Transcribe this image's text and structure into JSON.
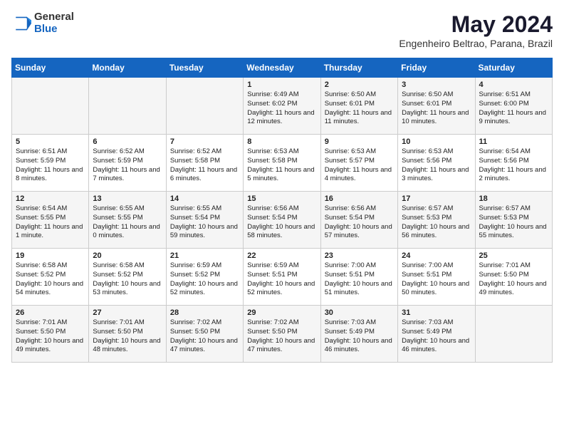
{
  "header": {
    "logo_general": "General",
    "logo_blue": "Blue",
    "month": "May 2024",
    "location": "Engenheiro Beltrao, Parana, Brazil"
  },
  "weekdays": [
    "Sunday",
    "Monday",
    "Tuesday",
    "Wednesday",
    "Thursday",
    "Friday",
    "Saturday"
  ],
  "weeks": [
    [
      {
        "day": "",
        "info": ""
      },
      {
        "day": "",
        "info": ""
      },
      {
        "day": "",
        "info": ""
      },
      {
        "day": "1",
        "info": "Sunrise: 6:49 AM\nSunset: 6:02 PM\nDaylight: 11 hours and 12 minutes."
      },
      {
        "day": "2",
        "info": "Sunrise: 6:50 AM\nSunset: 6:01 PM\nDaylight: 11 hours and 11 minutes."
      },
      {
        "day": "3",
        "info": "Sunrise: 6:50 AM\nSunset: 6:01 PM\nDaylight: 11 hours and 10 minutes."
      },
      {
        "day": "4",
        "info": "Sunrise: 6:51 AM\nSunset: 6:00 PM\nDaylight: 11 hours and 9 minutes."
      }
    ],
    [
      {
        "day": "5",
        "info": "Sunrise: 6:51 AM\nSunset: 5:59 PM\nDaylight: 11 hours and 8 minutes."
      },
      {
        "day": "6",
        "info": "Sunrise: 6:52 AM\nSunset: 5:59 PM\nDaylight: 11 hours and 7 minutes."
      },
      {
        "day": "7",
        "info": "Sunrise: 6:52 AM\nSunset: 5:58 PM\nDaylight: 11 hours and 6 minutes."
      },
      {
        "day": "8",
        "info": "Sunrise: 6:53 AM\nSunset: 5:58 PM\nDaylight: 11 hours and 5 minutes."
      },
      {
        "day": "9",
        "info": "Sunrise: 6:53 AM\nSunset: 5:57 PM\nDaylight: 11 hours and 4 minutes."
      },
      {
        "day": "10",
        "info": "Sunrise: 6:53 AM\nSunset: 5:56 PM\nDaylight: 11 hours and 3 minutes."
      },
      {
        "day": "11",
        "info": "Sunrise: 6:54 AM\nSunset: 5:56 PM\nDaylight: 11 hours and 2 minutes."
      }
    ],
    [
      {
        "day": "12",
        "info": "Sunrise: 6:54 AM\nSunset: 5:55 PM\nDaylight: 11 hours and 1 minute."
      },
      {
        "day": "13",
        "info": "Sunrise: 6:55 AM\nSunset: 5:55 PM\nDaylight: 11 hours and 0 minutes."
      },
      {
        "day": "14",
        "info": "Sunrise: 6:55 AM\nSunset: 5:54 PM\nDaylight: 10 hours and 59 minutes."
      },
      {
        "day": "15",
        "info": "Sunrise: 6:56 AM\nSunset: 5:54 PM\nDaylight: 10 hours and 58 minutes."
      },
      {
        "day": "16",
        "info": "Sunrise: 6:56 AM\nSunset: 5:54 PM\nDaylight: 10 hours and 57 minutes."
      },
      {
        "day": "17",
        "info": "Sunrise: 6:57 AM\nSunset: 5:53 PM\nDaylight: 10 hours and 56 minutes."
      },
      {
        "day": "18",
        "info": "Sunrise: 6:57 AM\nSunset: 5:53 PM\nDaylight: 10 hours and 55 minutes."
      }
    ],
    [
      {
        "day": "19",
        "info": "Sunrise: 6:58 AM\nSunset: 5:52 PM\nDaylight: 10 hours and 54 minutes."
      },
      {
        "day": "20",
        "info": "Sunrise: 6:58 AM\nSunset: 5:52 PM\nDaylight: 10 hours and 53 minutes."
      },
      {
        "day": "21",
        "info": "Sunrise: 6:59 AM\nSunset: 5:52 PM\nDaylight: 10 hours and 52 minutes."
      },
      {
        "day": "22",
        "info": "Sunrise: 6:59 AM\nSunset: 5:51 PM\nDaylight: 10 hours and 52 minutes."
      },
      {
        "day": "23",
        "info": "Sunrise: 7:00 AM\nSunset: 5:51 PM\nDaylight: 10 hours and 51 minutes."
      },
      {
        "day": "24",
        "info": "Sunrise: 7:00 AM\nSunset: 5:51 PM\nDaylight: 10 hours and 50 minutes."
      },
      {
        "day": "25",
        "info": "Sunrise: 7:01 AM\nSunset: 5:50 PM\nDaylight: 10 hours and 49 minutes."
      }
    ],
    [
      {
        "day": "26",
        "info": "Sunrise: 7:01 AM\nSunset: 5:50 PM\nDaylight: 10 hours and 49 minutes."
      },
      {
        "day": "27",
        "info": "Sunrise: 7:01 AM\nSunset: 5:50 PM\nDaylight: 10 hours and 48 minutes."
      },
      {
        "day": "28",
        "info": "Sunrise: 7:02 AM\nSunset: 5:50 PM\nDaylight: 10 hours and 47 minutes."
      },
      {
        "day": "29",
        "info": "Sunrise: 7:02 AM\nSunset: 5:50 PM\nDaylight: 10 hours and 47 minutes."
      },
      {
        "day": "30",
        "info": "Sunrise: 7:03 AM\nSunset: 5:49 PM\nDaylight: 10 hours and 46 minutes."
      },
      {
        "day": "31",
        "info": "Sunrise: 7:03 AM\nSunset: 5:49 PM\nDaylight: 10 hours and 46 minutes."
      },
      {
        "day": "",
        "info": ""
      }
    ]
  ]
}
